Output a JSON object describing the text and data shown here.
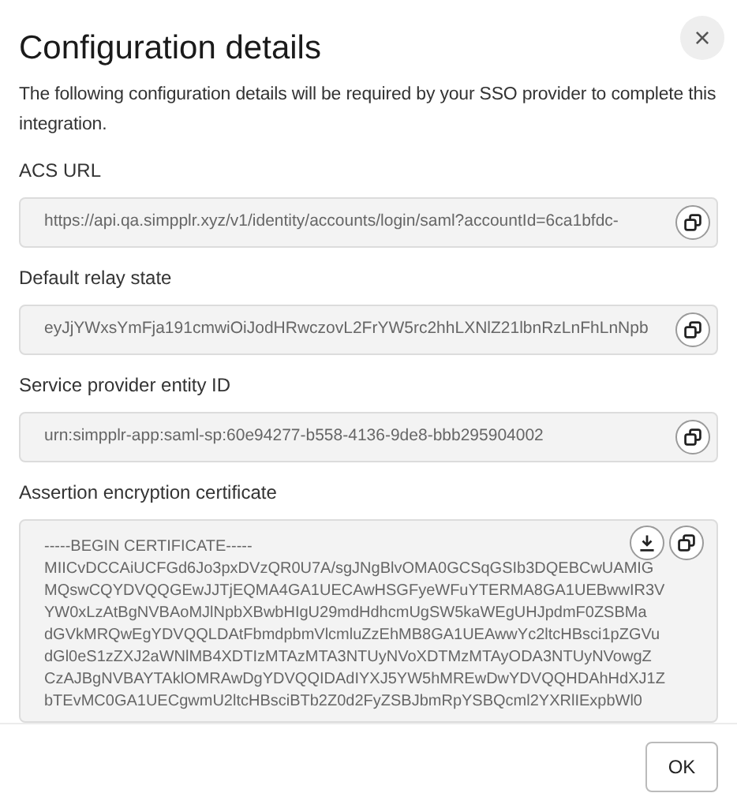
{
  "dialog": {
    "title": "Configuration details",
    "close_glyph": "×",
    "description": "The following configuration details will be required by your SSO provider to complete this integration."
  },
  "fields": [
    {
      "kind": "text",
      "label": "ACS URL",
      "value": "https://api.qa.simpplr.xyz/v1/identity/accounts/login/saml?accountId=6ca1bfdc-"
    },
    {
      "kind": "text",
      "label": "Default relay state",
      "value": "eyJjYWxsYmFja191cmwiOiJodHRwczovL2FrYW5rc2hhLXNlZ21lbnRzLnFhLnNpb"
    },
    {
      "kind": "text",
      "label": "Service provider entity ID",
      "value": "urn:simpplr-app:saml-sp:60e94277-b558-4136-9de8-bbb295904002"
    },
    {
      "kind": "certificate",
      "label": "Assertion encryption certificate",
      "lines": [
        "-----BEGIN CERTIFICATE-----",
        "MIICvDCCAiUCFGd6Jo3pxDVzQR0U7A/sgJNgBlvOMA0GCSqGSIb3DQEBCwUAMIG",
        "MQswCQYDVQQGEwJJTjEQMA4GA1UECAwHSGFyeWFuYTERMA8GA1UEBwwIR3V",
        "YW0xLzAtBgNVBAoMJlNpbXBwbHIgU29mdHdhcmUgSW5kaWEgUHJpdmF0ZSBMa",
        "dGVkMRQwEgYDVQQLDAtFbmdpbmVlcmluZzEhMB8GA1UEAwwYc2ltcHBsci1pZGVu",
        "dGl0eS1zZXJ2aWNlMB4XDTIzMTAzMTA3NTUyNVoXDTMzMTAyODA3NTUyNVowgZ",
        "CzAJBgNVBAYTAklOMRAwDgYDVQQIDAdIYXJ5YW5hMREwDwYDVQQHDAhHdXJ1Z",
        "bTEvMC0GA1UECgwmU2ltcHBsciBTb2Z0d2FyZSBJbmRpYSBQcml2YXRlIExpbWl0"
      ]
    }
  ],
  "footer": {
    "ok_button": "OK"
  }
}
